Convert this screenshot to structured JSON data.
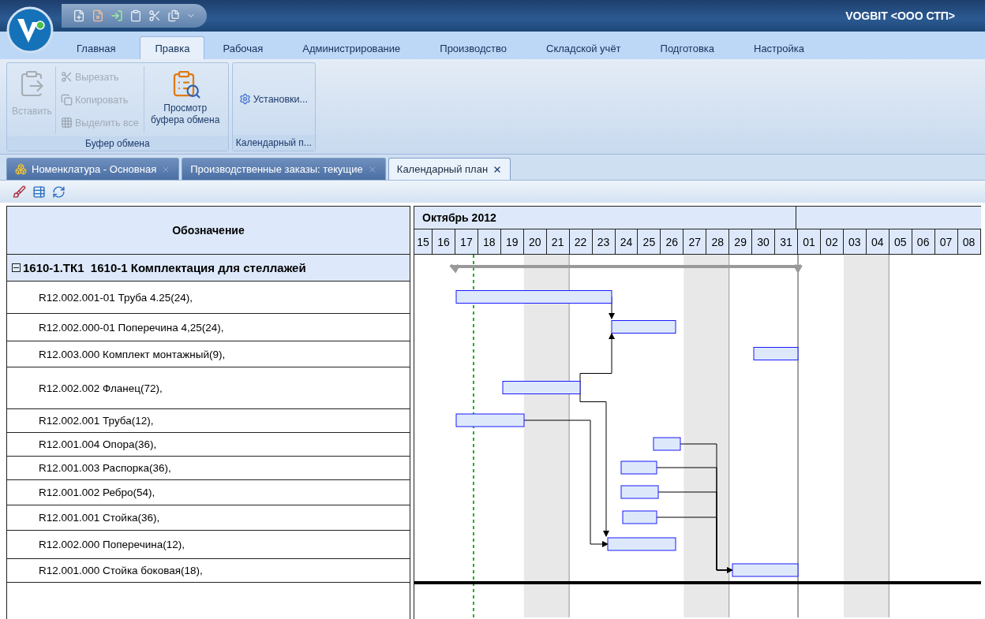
{
  "window": {
    "title": "VOGBIT <ООО СТП>"
  },
  "ribbon_tabs": [
    {
      "label": "Главная",
      "selected": false
    },
    {
      "label": "Правка",
      "selected": true
    },
    {
      "label": "Рабочая",
      "selected": false
    },
    {
      "label": "Администрирование",
      "selected": false
    },
    {
      "label": "Производство",
      "selected": false
    },
    {
      "label": "Складской учёт",
      "selected": false
    },
    {
      "label": "Подготовка",
      "selected": false
    },
    {
      "label": "Настройка",
      "selected": false
    }
  ],
  "ribbon_groups": [
    {
      "label": "Буфер обмена",
      "large_buttons": [
        {
          "kind": "paste",
          "label": "Вставить",
          "disabled": true
        },
        {
          "kind": "view",
          "label": "Просмотр буфера обмена",
          "disabled": false
        }
      ],
      "small_buttons": [
        {
          "kind": "cut",
          "label": "Вырезать",
          "disabled": true
        },
        {
          "kind": "copy",
          "label": "Копировать",
          "disabled": true
        },
        {
          "kind": "select",
          "label": "Выделить все",
          "disabled": true
        }
      ]
    },
    {
      "label": "Календарный п...",
      "small_buttons": [
        {
          "kind": "settings",
          "label": "Установки...",
          "disabled": false
        }
      ]
    }
  ],
  "doc_tabs": [
    {
      "label": "Номенклатура - Основная",
      "selected": false,
      "kind": "nomenclature"
    },
    {
      "label": "Производственные заказы: текущие",
      "selected": false,
      "kind": "plain"
    },
    {
      "label": "Календарный план",
      "selected": true,
      "kind": "plain"
    }
  ],
  "grid": {
    "column_header": "Обозначение",
    "month": "Октябрь 2012",
    "days": [
      "15",
      "16",
      "17",
      "18",
      "19",
      "20",
      "21",
      "22",
      "23",
      "24",
      "25",
      "26",
      "27",
      "28",
      "29",
      "30",
      "31",
      "01",
      "02",
      "03",
      "04",
      "05",
      "06",
      "07",
      "08"
    ],
    "group": {
      "label": "1610-1.ТК1  1610-1 Комплектация для стеллажей",
      "expanded": true
    },
    "rows": [
      {
        "label": "R12.002.001-01 Труба 4.25(24),"
      },
      {
        "label": "R12.002.000-01 Поперечина 4,25(24),"
      },
      {
        "label": "R12.003.000 Комплект монтажный(9),"
      },
      {
        "label": "R12.002.002 Фланец(72),"
      },
      {
        "label": "R12.002.001 Труба(12),"
      },
      {
        "label": "R12.001.004 Опора(36),"
      },
      {
        "label": "R12.001.003 Распорка(36),"
      },
      {
        "label": "R12.001.002 Ребро(54),"
      },
      {
        "label": "R12.001.001 Стойка(36),"
      },
      {
        "label": "R12.002.000 Поперечина(12),"
      },
      {
        "label": "R12.001.000 Стойка боковая(18),"
      }
    ]
  }
}
